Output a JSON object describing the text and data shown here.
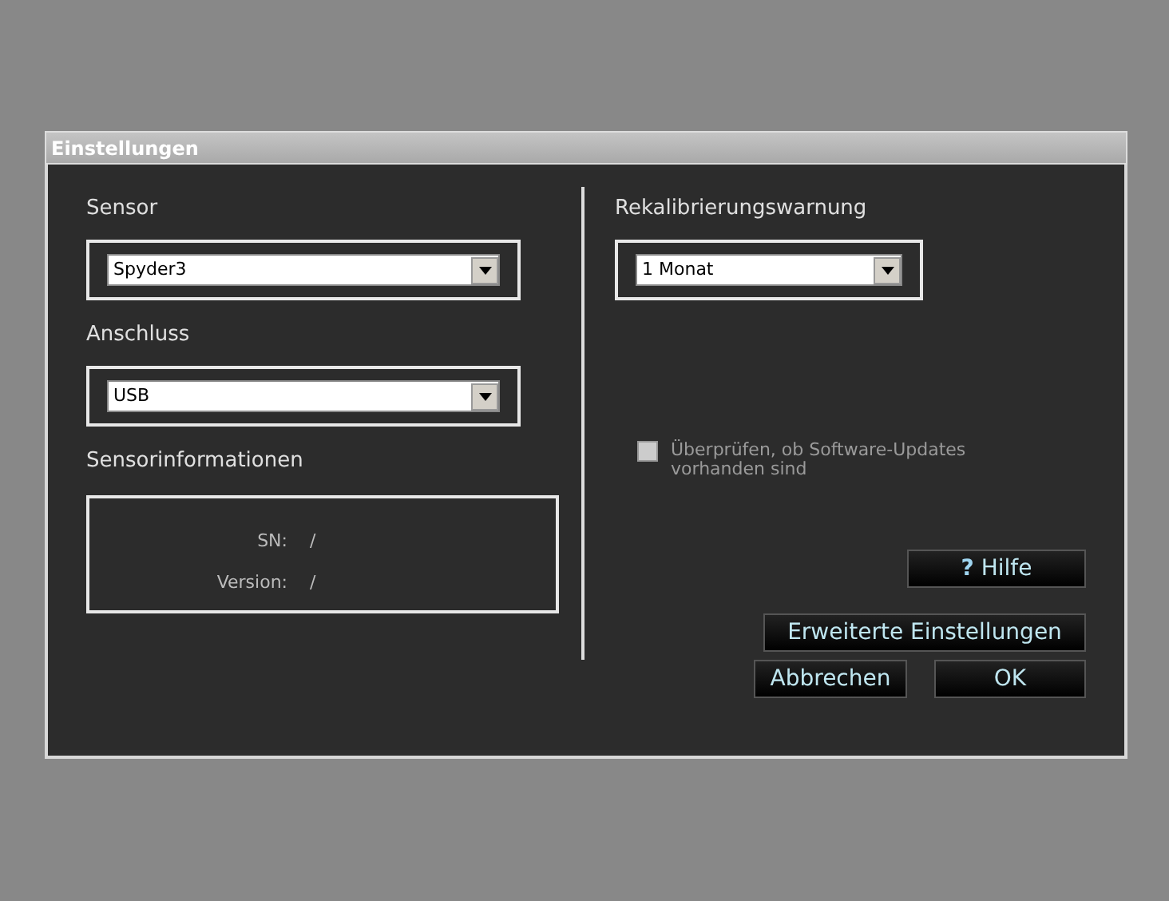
{
  "window": {
    "title": "Einstellungen"
  },
  "left": {
    "selects": [
      {
        "label": "Sensor",
        "value": "Spyder3"
      },
      {
        "label": "Anschluss",
        "value": "USB"
      }
    ],
    "info": {
      "label": "Sensorinformationen",
      "rows": [
        {
          "key": "SN:",
          "value": "/"
        },
        {
          "key": "Version:",
          "value": "/"
        }
      ]
    }
  },
  "right": {
    "select": {
      "label": "Rekalibrierungswarnung",
      "value": "1 Monat"
    },
    "checkbox": {
      "label": "Überprüfen, ob Software-Updates vorhanden sind",
      "checked": false,
      "disabled": true
    }
  },
  "buttons": [
    {
      "kind": "help",
      "icon": "?",
      "label": "Hilfe"
    },
    {
      "kind": "wide",
      "label": "Erweiterte Einstellungen"
    },
    {
      "kind": "cancel",
      "label": "Abbrechen"
    },
    {
      "kind": "ok",
      "label": "OK"
    }
  ]
}
